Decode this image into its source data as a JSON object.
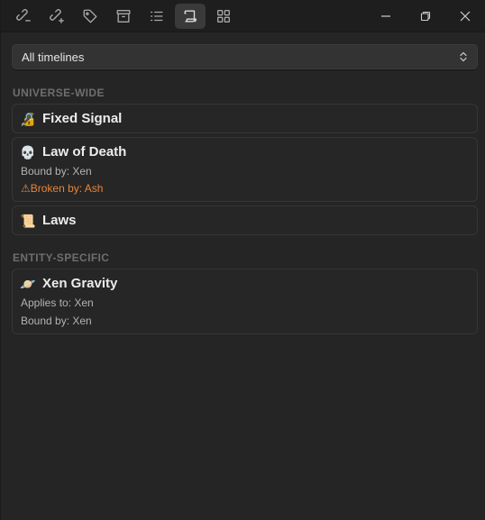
{
  "toolbar": {
    "buttons": [
      {
        "icon": "link-remove-icon"
      },
      {
        "icon": "link-add-icon"
      },
      {
        "icon": "tag-icon"
      },
      {
        "icon": "archive-icon"
      },
      {
        "icon": "list-icon"
      },
      {
        "icon": "scroll-icon",
        "active": true
      },
      {
        "icon": "grid-icon"
      }
    ],
    "window_controls": [
      "minimize-icon",
      "restore-icon",
      "close-icon"
    ]
  },
  "filter": {
    "selected": "All timelines"
  },
  "sections": {
    "universe_wide": {
      "heading": "UNIVERSE-WIDE",
      "items": [
        {
          "icon": "🔏",
          "icon_name": "pen-lock-icon",
          "title": "Fixed Signal"
        },
        {
          "icon": "💀",
          "icon_name": "skull-icon",
          "title": "Law of Death",
          "bound_by": "Bound by: Xen",
          "broken_by": "⚠Broken by: Ash"
        },
        {
          "icon": "📜",
          "icon_name": "scroll-icon",
          "title": "Laws"
        }
      ]
    },
    "entity_specific": {
      "heading": "ENTITY-SPECIFIC",
      "items": [
        {
          "icon": "🪐",
          "icon_name": "planet-icon",
          "title": "Xen Gravity",
          "applies_to": "Applies to: Xen",
          "bound_by": "Bound by: Xen"
        }
      ]
    }
  },
  "colors": {
    "background": "#252525",
    "toolbar": "#1e1e1e",
    "warning": "#e8853a",
    "muted_heading": "#6e6e6e"
  }
}
